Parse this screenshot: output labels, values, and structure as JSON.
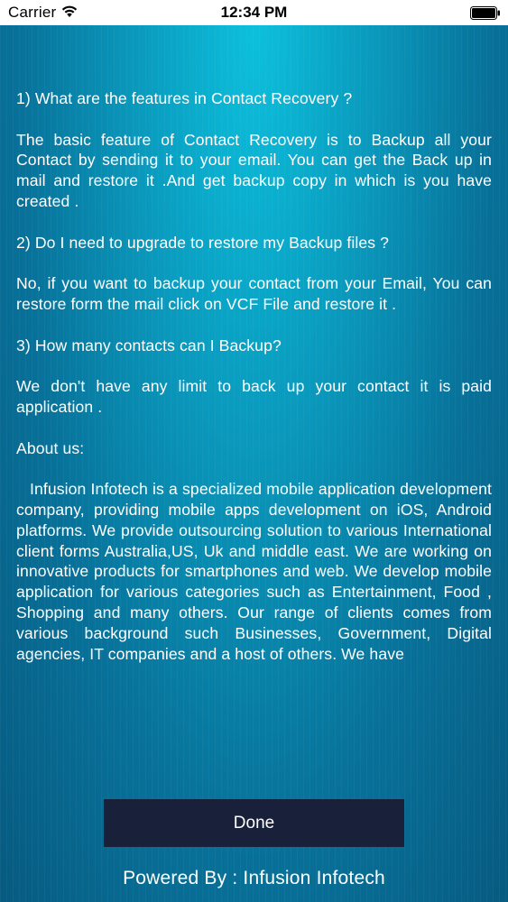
{
  "status_bar": {
    "carrier": "Carrier",
    "time": "12:34 PM",
    "wifi_icon": "wifi-icon",
    "battery_icon": "battery-icon"
  },
  "faq": {
    "q1": "1) What are the features in Contact Recovery ?",
    "a1": "The basic feature of Contact Recovery is to Backup all your Contact  by sending it to your email. You can get the Back up in mail and restore it .And get backup copy in which is you have created .",
    "q2": "2) Do I need to upgrade to restore my Backup files ?",
    "a2": "No, if you want to backup your contact from your Email, You can restore form the mail click on VCF File and restore it .",
    "q3": "3) How many contacts can I Backup?",
    "a3": "We don't have any limit to back up your contact it is paid application .",
    "about_heading": "About us:",
    "about_body": "Infusion Infotech is a specialized mobile application development company, providing mobile apps development on iOS, Android platforms. We provide outsourcing solution to various International client forms Australia,US, Uk and middle east. We are working on innovative products for smartphones and web. We develop mobile application for various categories such as Entertainment, Food , Shopping and many others. Our range of clients comes from various background such Businesses, Government, Digital agencies, IT companies and a host of others. We have"
  },
  "done_label": "Done",
  "powered_by": "Powered By : Infusion Infotech",
  "colors": {
    "background_top": "#0cc0dc",
    "background_bottom": "#075a80",
    "button_bg": "#18203a",
    "text": "#ffffff"
  }
}
